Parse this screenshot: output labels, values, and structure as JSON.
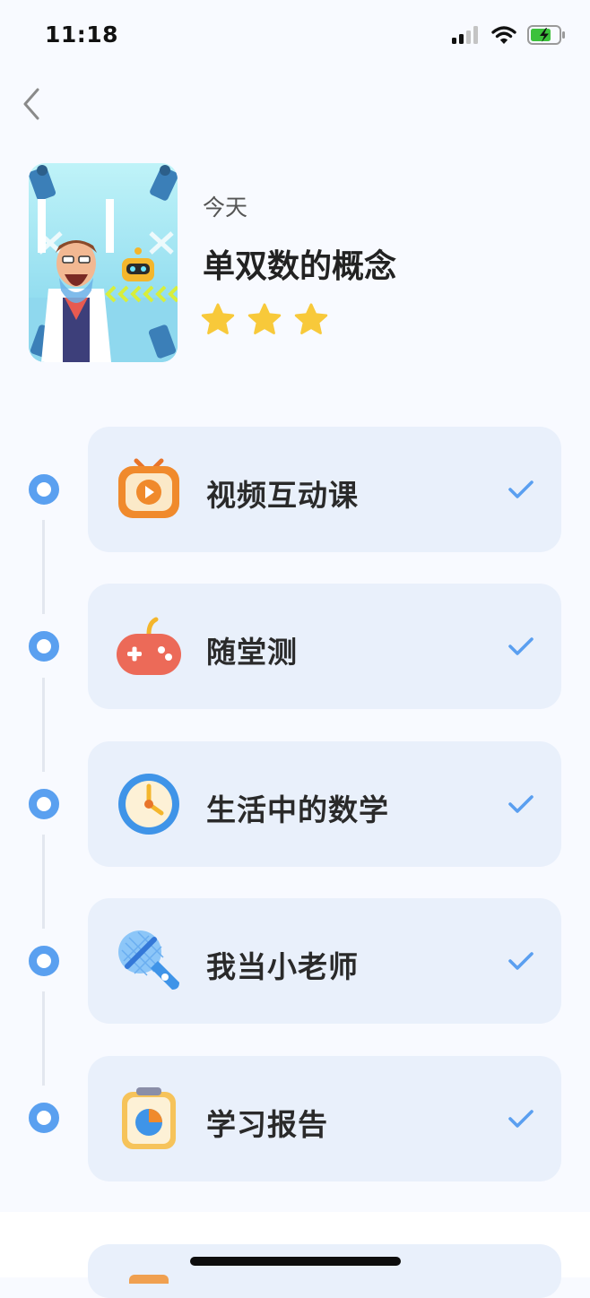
{
  "status_bar": {
    "time": "11:18"
  },
  "lesson": {
    "day_label": "今天",
    "title": "单双数的概念",
    "stars_earned": 3
  },
  "steps": [
    {
      "label": "视频互动课",
      "icon": "video-tv-icon",
      "completed": true
    },
    {
      "label": "随堂测",
      "icon": "gamepad-icon",
      "completed": true
    },
    {
      "label": "生活中的数学",
      "icon": "clock-icon",
      "completed": true
    },
    {
      "label": "我当小老师",
      "icon": "microphone-icon",
      "completed": true
    },
    {
      "label": "学习报告",
      "icon": "report-chart-icon",
      "completed": true
    }
  ],
  "colors": {
    "accent": "#5aa0f0",
    "card_bg": "#e9f0fb",
    "star": "#f8c93a",
    "check": "#5a9ff0"
  }
}
